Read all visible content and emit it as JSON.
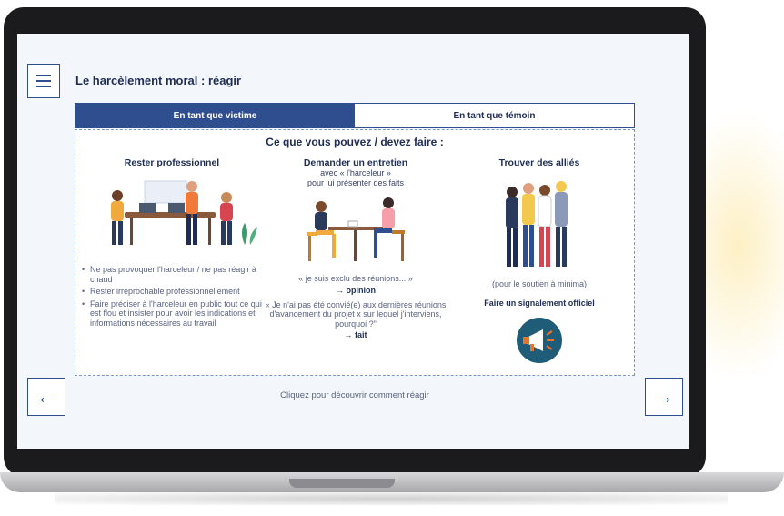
{
  "page": {
    "title": "Le harcèlement moral : réagir"
  },
  "tabs": [
    {
      "label": "En tant que victime",
      "active": true
    },
    {
      "label": "En tant que témoin",
      "active": false
    }
  ],
  "panel": {
    "heading": "Ce que vous pouvez / devez faire :",
    "col1": {
      "title": "Rester professionnel",
      "bullets": [
        "Ne pas provoquer l'harceleur / ne pas réagir à chaud",
        "Rester irréprochable professionnellement",
        "Faire préciser à l'harceleur en public tout ce qui est flou et insister pour avoir les indications et informations nécessaires au travail"
      ]
    },
    "col2": {
      "title": "Demander un entretien",
      "sub1": "avec « l'harceleur »",
      "sub2": "pour lui présenter des faits",
      "quote1": "« je suis exclu des réunions... »",
      "label1": "→ opinion",
      "quote2": "« Je n'ai pas été convié(e) aux dernières réunions d'avancement du projet x sur lequel j'interviens, pourquoi ?\"",
      "label2": "→ fait"
    },
    "col3": {
      "title": "Trouver des alliés",
      "note": "(pour le soutien à minima)",
      "action": "Faire un signalement officiel"
    }
  },
  "footer": {
    "hint": "Cliquez pour découvrir comment réagir"
  },
  "icons": {
    "menu": "hamburger-menu-icon",
    "prev": "arrow-left-icon",
    "next": "arrow-right-icon",
    "megaphone": "megaphone-icon"
  },
  "colors": {
    "primary": "#2f4e8f",
    "text_dark": "#1f2d55",
    "megaphone_bg": "#1f5c78",
    "megaphone_accent": "#e8752d"
  }
}
